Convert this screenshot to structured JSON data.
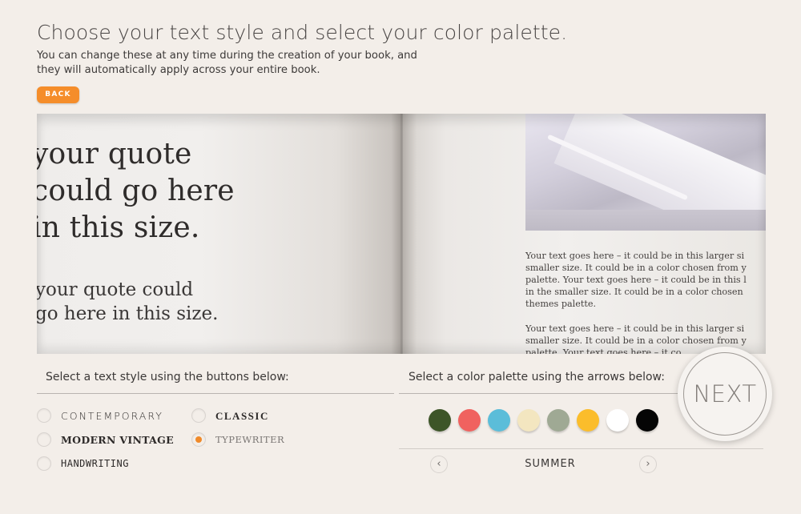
{
  "header": {
    "title": "Choose your text style and select your color palette.",
    "subtitle": "You can change these at any time during the creation of your book, and they will automatically apply across your entire book.",
    "back_label": "BACK"
  },
  "preview": {
    "quote_large": [
      "your quote",
      "could go here",
      "in this size."
    ],
    "quote_small": [
      "your quote could",
      "go here in this size."
    ],
    "body_paragraph_1": [
      "Your text goes here – it could be in this larger si",
      "smaller size. It could be in a color chosen from y",
      "palette. Your text goes here – it could be in this l",
      "in the smaller size. It could be in a color chosen",
      "themes palette."
    ],
    "body_paragraph_2": [
      "Your text goes here – it could be in this larger si",
      "smaller size. It could be in a color chosen from y",
      "palette. Your text goes here – it co"
    ]
  },
  "text_style": {
    "label": "Select a text style using the buttons below:",
    "options": [
      {
        "label": "CONTEMPORARY",
        "selected": false
      },
      {
        "label": "MODERN VINTAGE",
        "selected": false
      },
      {
        "label": "HANDWRITING",
        "selected": false
      },
      {
        "label": "CLASSIC",
        "selected": false
      },
      {
        "label": "TYPEWRITER",
        "selected": true
      }
    ]
  },
  "color_palette": {
    "label": "Select a color palette using the arrows below:",
    "palette_name": "SUMMER",
    "swatches": [
      "#3d5528",
      "#f0625f",
      "#5bbdd9",
      "#f3e6c0",
      "#9fa994",
      "#fbbd2b",
      "#ffffff",
      "#050505"
    ],
    "prev_icon": "chevron-left-icon",
    "next_icon": "chevron-right-icon"
  },
  "next_label": "NEXT",
  "accent_color": "#f58d2a"
}
